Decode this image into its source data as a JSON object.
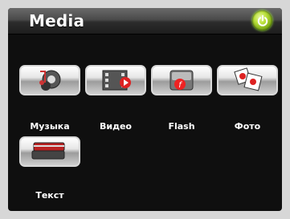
{
  "header": {
    "title": "Media"
  },
  "menu": {
    "items": [
      {
        "id": "music",
        "label": "Музыка",
        "icon": "music-notes-icon"
      },
      {
        "id": "video",
        "label": "Видео",
        "icon": "film-strip-play-icon"
      },
      {
        "id": "flash",
        "label": "Flash",
        "icon": "flash-icon"
      },
      {
        "id": "photo",
        "label": "Фото",
        "icon": "photos-icon"
      },
      {
        "id": "text",
        "label": "Текст",
        "icon": "books-icon"
      }
    ]
  },
  "colors": {
    "background": "#0f0f0f",
    "accent_power": "#9fd629",
    "text": "#ffffff"
  }
}
